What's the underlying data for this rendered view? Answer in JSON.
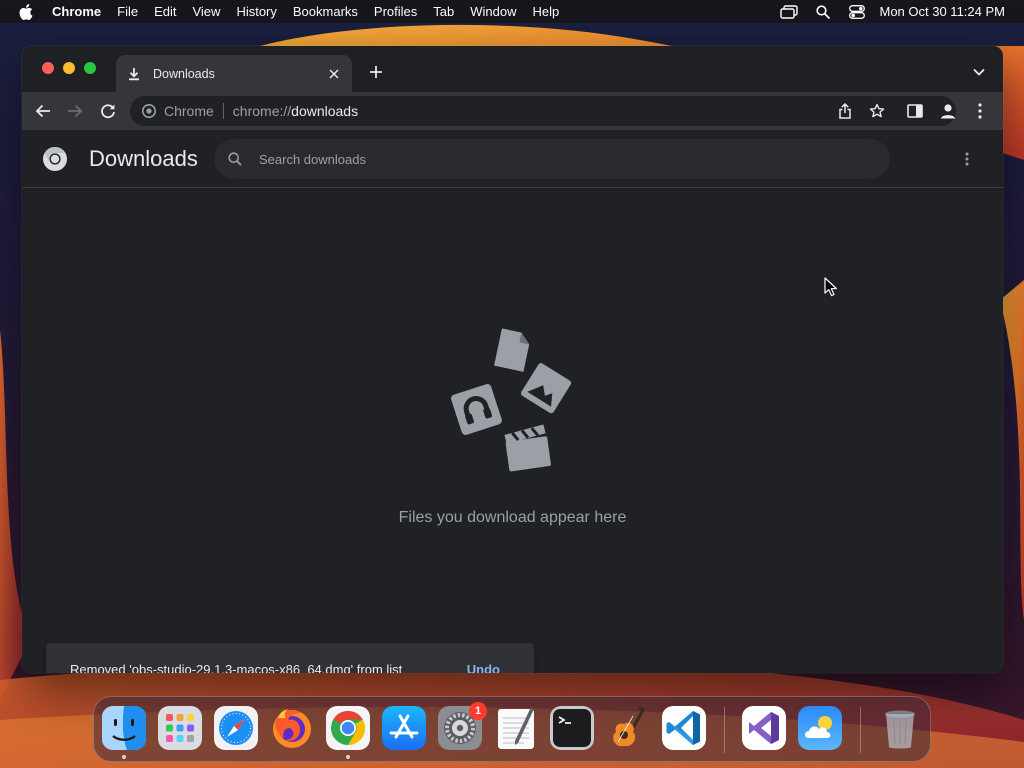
{
  "menubar": {
    "app_name": "Chrome",
    "items": [
      "File",
      "Edit",
      "View",
      "History",
      "Bookmarks",
      "Profiles",
      "Tab",
      "Window",
      "Help"
    ],
    "clock": "Mon Oct 30  11:24 PM"
  },
  "browser": {
    "tab": {
      "title": "Downloads"
    },
    "omnibox": {
      "site_name": "Chrome",
      "url_scheme": "chrome://",
      "url_host": "downloads"
    }
  },
  "downloads_page": {
    "title": "Downloads",
    "search_placeholder": "Search downloads",
    "empty_message": "Files you download appear here",
    "toast": {
      "message": "Removed 'obs-studio-29.1.3-macos-x86_64.dmg' from list",
      "action": "Undo"
    }
  },
  "dock": {
    "apps": [
      {
        "name": "Finder",
        "icon": "finder-icon",
        "running": true
      },
      {
        "name": "Launchpad",
        "icon": "launchpad-icon",
        "running": false
      },
      {
        "name": "Safari",
        "icon": "safari-icon",
        "running": false
      },
      {
        "name": "Firefox",
        "icon": "firefox-icon",
        "running": false
      },
      {
        "name": "Google Chrome",
        "icon": "chrome-icon",
        "running": true
      },
      {
        "name": "App Store",
        "icon": "app-store-icon",
        "running": false
      },
      {
        "name": "System Settings",
        "icon": "system-settings-icon",
        "running": false,
        "badge": "1"
      },
      {
        "name": "TextEdit",
        "icon": "textedit-icon",
        "running": false
      },
      {
        "name": "Terminal",
        "icon": "terminal-icon",
        "running": false
      },
      {
        "name": "GarageBand",
        "icon": "garageband-icon",
        "running": false
      },
      {
        "name": "Visual Studio Code",
        "icon": "vscode-icon",
        "running": false
      },
      {
        "name": "Visual Studio",
        "icon": "visual-studio-icon",
        "running": false
      },
      {
        "name": "Weather",
        "icon": "weather-icon",
        "running": false
      },
      {
        "name": "Trash",
        "icon": "trash-icon",
        "running": false
      }
    ]
  },
  "colors": {
    "window_bg": "#202124",
    "toolbar_bg": "#35363a",
    "link_blue": "#8ab4f8",
    "text_primary": "#e8eaed",
    "text_secondary": "#9aa0a6"
  }
}
